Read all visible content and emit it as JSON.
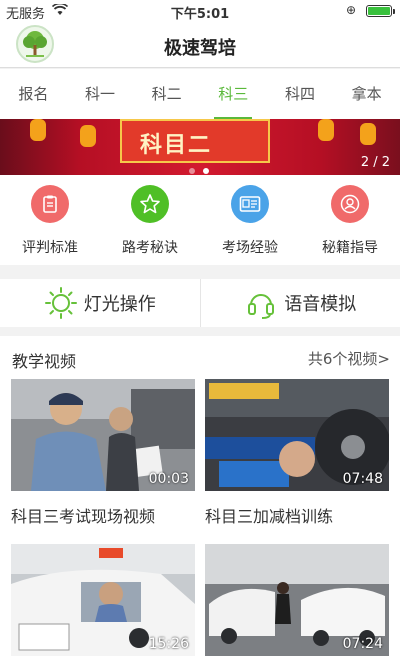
{
  "status": {
    "carrier": "无服务",
    "time": "下午5:01",
    "lock_icon": "rotation-lock-icon",
    "battery_icon": "battery-icon"
  },
  "header": {
    "title": "极速驾培",
    "logo_icon": "tree-logo-icon"
  },
  "tabs": [
    {
      "label": "报名",
      "active": false
    },
    {
      "label": "科一",
      "active": false
    },
    {
      "label": "科二",
      "active": false
    },
    {
      "label": "科三",
      "active": true
    },
    {
      "label": "科四",
      "active": false
    },
    {
      "label": "拿本",
      "active": false
    }
  ],
  "banner": {
    "counter": "2 / 2",
    "center_text": "科目二"
  },
  "features": [
    {
      "label": "评判标准",
      "color": "#f06a6a",
      "icon": "clipboard-icon"
    },
    {
      "label": "路考秘诀",
      "color": "#4fbf26",
      "icon": "star-icon"
    },
    {
      "label": "考场经验",
      "color": "#4aa3e8",
      "icon": "id-card-icon"
    },
    {
      "label": "秘籍指导",
      "color": "#f06a6a",
      "icon": "user-icon"
    }
  ],
  "modes": [
    {
      "label": "灯光操作",
      "icon": "sun-icon",
      "color": "#66c13a"
    },
    {
      "label": "语音模拟",
      "icon": "headset-icon",
      "color": "#66c13a"
    }
  ],
  "videos": {
    "heading": "教学视频",
    "more": "共6个视频>",
    "items": [
      {
        "title": "科目三考试现场视频",
        "duration": "00:03"
      },
      {
        "title": "科目三加减档训练",
        "duration": "07:48"
      },
      {
        "title": "",
        "duration": "15:26"
      },
      {
        "title": "",
        "duration": "07:24"
      }
    ]
  }
}
